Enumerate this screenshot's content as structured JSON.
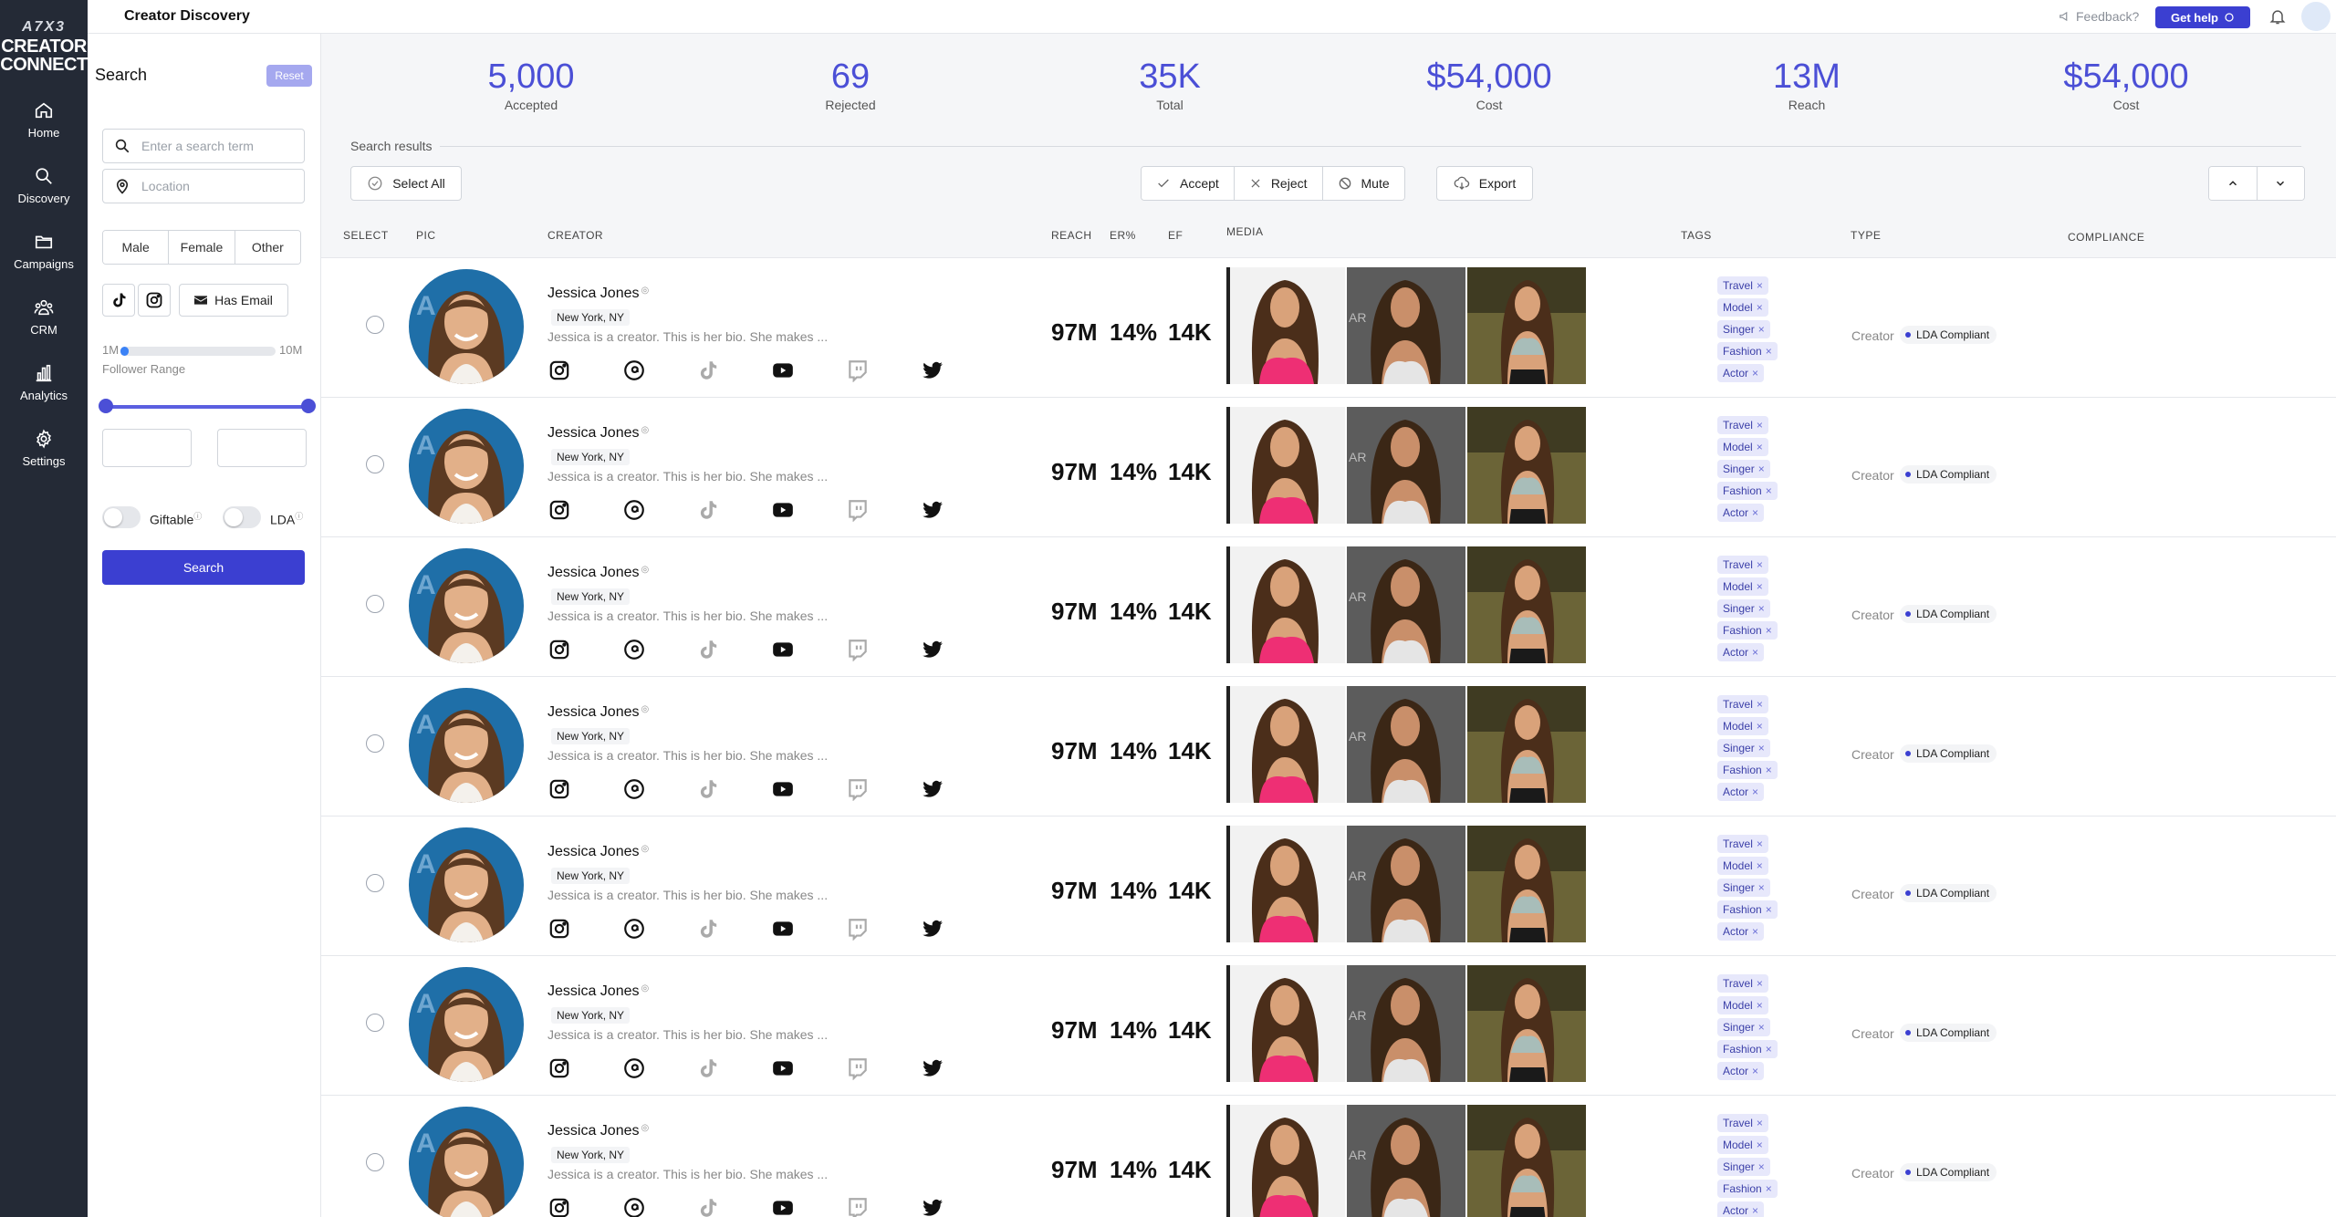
{
  "nav": {
    "logo": {
      "line1": "A7X3",
      "line2": "CREATOR",
      "line3": "CONNECT"
    },
    "items": [
      {
        "label": "Home",
        "icon": "home-icon"
      },
      {
        "label": "Discovery",
        "icon": "search-icon"
      },
      {
        "label": "Campaigns",
        "icon": "folder-icon"
      },
      {
        "label": "CRM",
        "icon": "users-icon"
      },
      {
        "label": "Analytics",
        "icon": "bar-chart-icon"
      },
      {
        "label": "Settings",
        "icon": "gear-icon"
      }
    ]
  },
  "header": {
    "title": "Creator Discovery",
    "feedback": "Feedback?",
    "get_help": "Get help"
  },
  "search_panel": {
    "title": "Search",
    "reset": "Reset",
    "search_placeholder": "Enter a search term",
    "location_placeholder": "Location",
    "gender": [
      "Male",
      "Female",
      "Other"
    ],
    "has_email": "Has Email",
    "range_min": "1M",
    "range_max": "10M",
    "range_label": "Follower Range",
    "follower_range_fraction": 0.05,
    "giftable": "Giftable",
    "lda": "LDA",
    "search_button": "Search"
  },
  "stats": [
    {
      "value": "5,000",
      "label": "Accepted"
    },
    {
      "value": "69",
      "label": "Rejected"
    },
    {
      "value": "35K",
      "label": "Total"
    },
    {
      "value": "$54,000",
      "label": "Cost"
    },
    {
      "value": "13M",
      "label": "Reach"
    },
    {
      "value": "$54,000",
      "label": "Cost"
    }
  ],
  "results": {
    "label": "Search results",
    "select_all": "Select All",
    "accept": "Accept",
    "reject": "Reject",
    "mute": "Mute",
    "export": "Export"
  },
  "columns": {
    "select": "SELECT",
    "pic": "PIC",
    "creator": "CREATOR",
    "reach": "REACH",
    "er": "ER%",
    "ef": "EF",
    "media": "MEDIA",
    "tags": "TAGS",
    "type": "TYPE",
    "compliance": "COMPLIANCE"
  },
  "rows": [
    {
      "name": "Jessica Jones",
      "location": "New York, NY",
      "bio": "Jessica is a creator. This is her bio. She makes ...",
      "reach": "97M",
      "er": "14%",
      "ef": "14K",
      "tags": [
        "Travel",
        "Model",
        "Singer",
        "Fashion",
        "Actor"
      ],
      "type": "Creator",
      "compliance": "LDA Compliant"
    },
    {
      "name": "Jessica Jones",
      "location": "New York, NY",
      "bio": "Jessica is a creator. This is her bio. She makes ...",
      "reach": "97M",
      "er": "14%",
      "ef": "14K",
      "tags": [
        "Travel",
        "Model",
        "Singer",
        "Fashion",
        "Actor"
      ],
      "type": "Creator",
      "compliance": "LDA Compliant"
    },
    {
      "name": "Jessica Jones",
      "location": "New York, NY",
      "bio": "Jessica is a creator. This is her bio. She makes ...",
      "reach": "97M",
      "er": "14%",
      "ef": "14K",
      "tags": [
        "Travel",
        "Model",
        "Singer",
        "Fashion",
        "Actor"
      ],
      "type": "Creator",
      "compliance": "LDA Compliant"
    },
    {
      "name": "Jessica Jones",
      "location": "New York, NY",
      "bio": "Jessica is a creator. This is her bio. She makes ...",
      "reach": "97M",
      "er": "14%",
      "ef": "14K",
      "tags": [
        "Travel",
        "Model",
        "Singer",
        "Fashion",
        "Actor"
      ],
      "type": "Creator",
      "compliance": "LDA Compliant"
    },
    {
      "name": "Jessica Jones",
      "location": "New York, NY",
      "bio": "Jessica is a creator. This is her bio. She makes ...",
      "reach": "97M",
      "er": "14%",
      "ef": "14K",
      "tags": [
        "Travel",
        "Model",
        "Singer",
        "Fashion",
        "Actor"
      ],
      "type": "Creator",
      "compliance": "LDA Compliant"
    },
    {
      "name": "Jessica Jones",
      "location": "New York, NY",
      "bio": "Jessica is a creator. This is her bio. She makes ...",
      "reach": "97M",
      "er": "14%",
      "ef": "14K",
      "tags": [
        "Travel",
        "Model",
        "Singer",
        "Fashion",
        "Actor"
      ],
      "type": "Creator",
      "compliance": "LDA Compliant"
    },
    {
      "name": "Jessica Jones",
      "location": "New York, NY",
      "bio": "Jessica is a creator. This is her bio. She makes ...",
      "reach": "97M",
      "er": "14%",
      "ef": "14K",
      "tags": [
        "Travel",
        "Model",
        "Singer",
        "Fashion",
        "Actor"
      ],
      "type": "Creator",
      "compliance": "LDA Compliant"
    }
  ],
  "social_icons": [
    "instagram-icon",
    "threads-icon",
    "tiktok-icon",
    "youtube-icon",
    "twitch-icon",
    "twitter-icon"
  ],
  "colors": {
    "accent": "#3b3fd1",
    "nav_bg": "#242a36",
    "stat": "#4b4fd6",
    "tag_bg": "#e7e8fb"
  }
}
